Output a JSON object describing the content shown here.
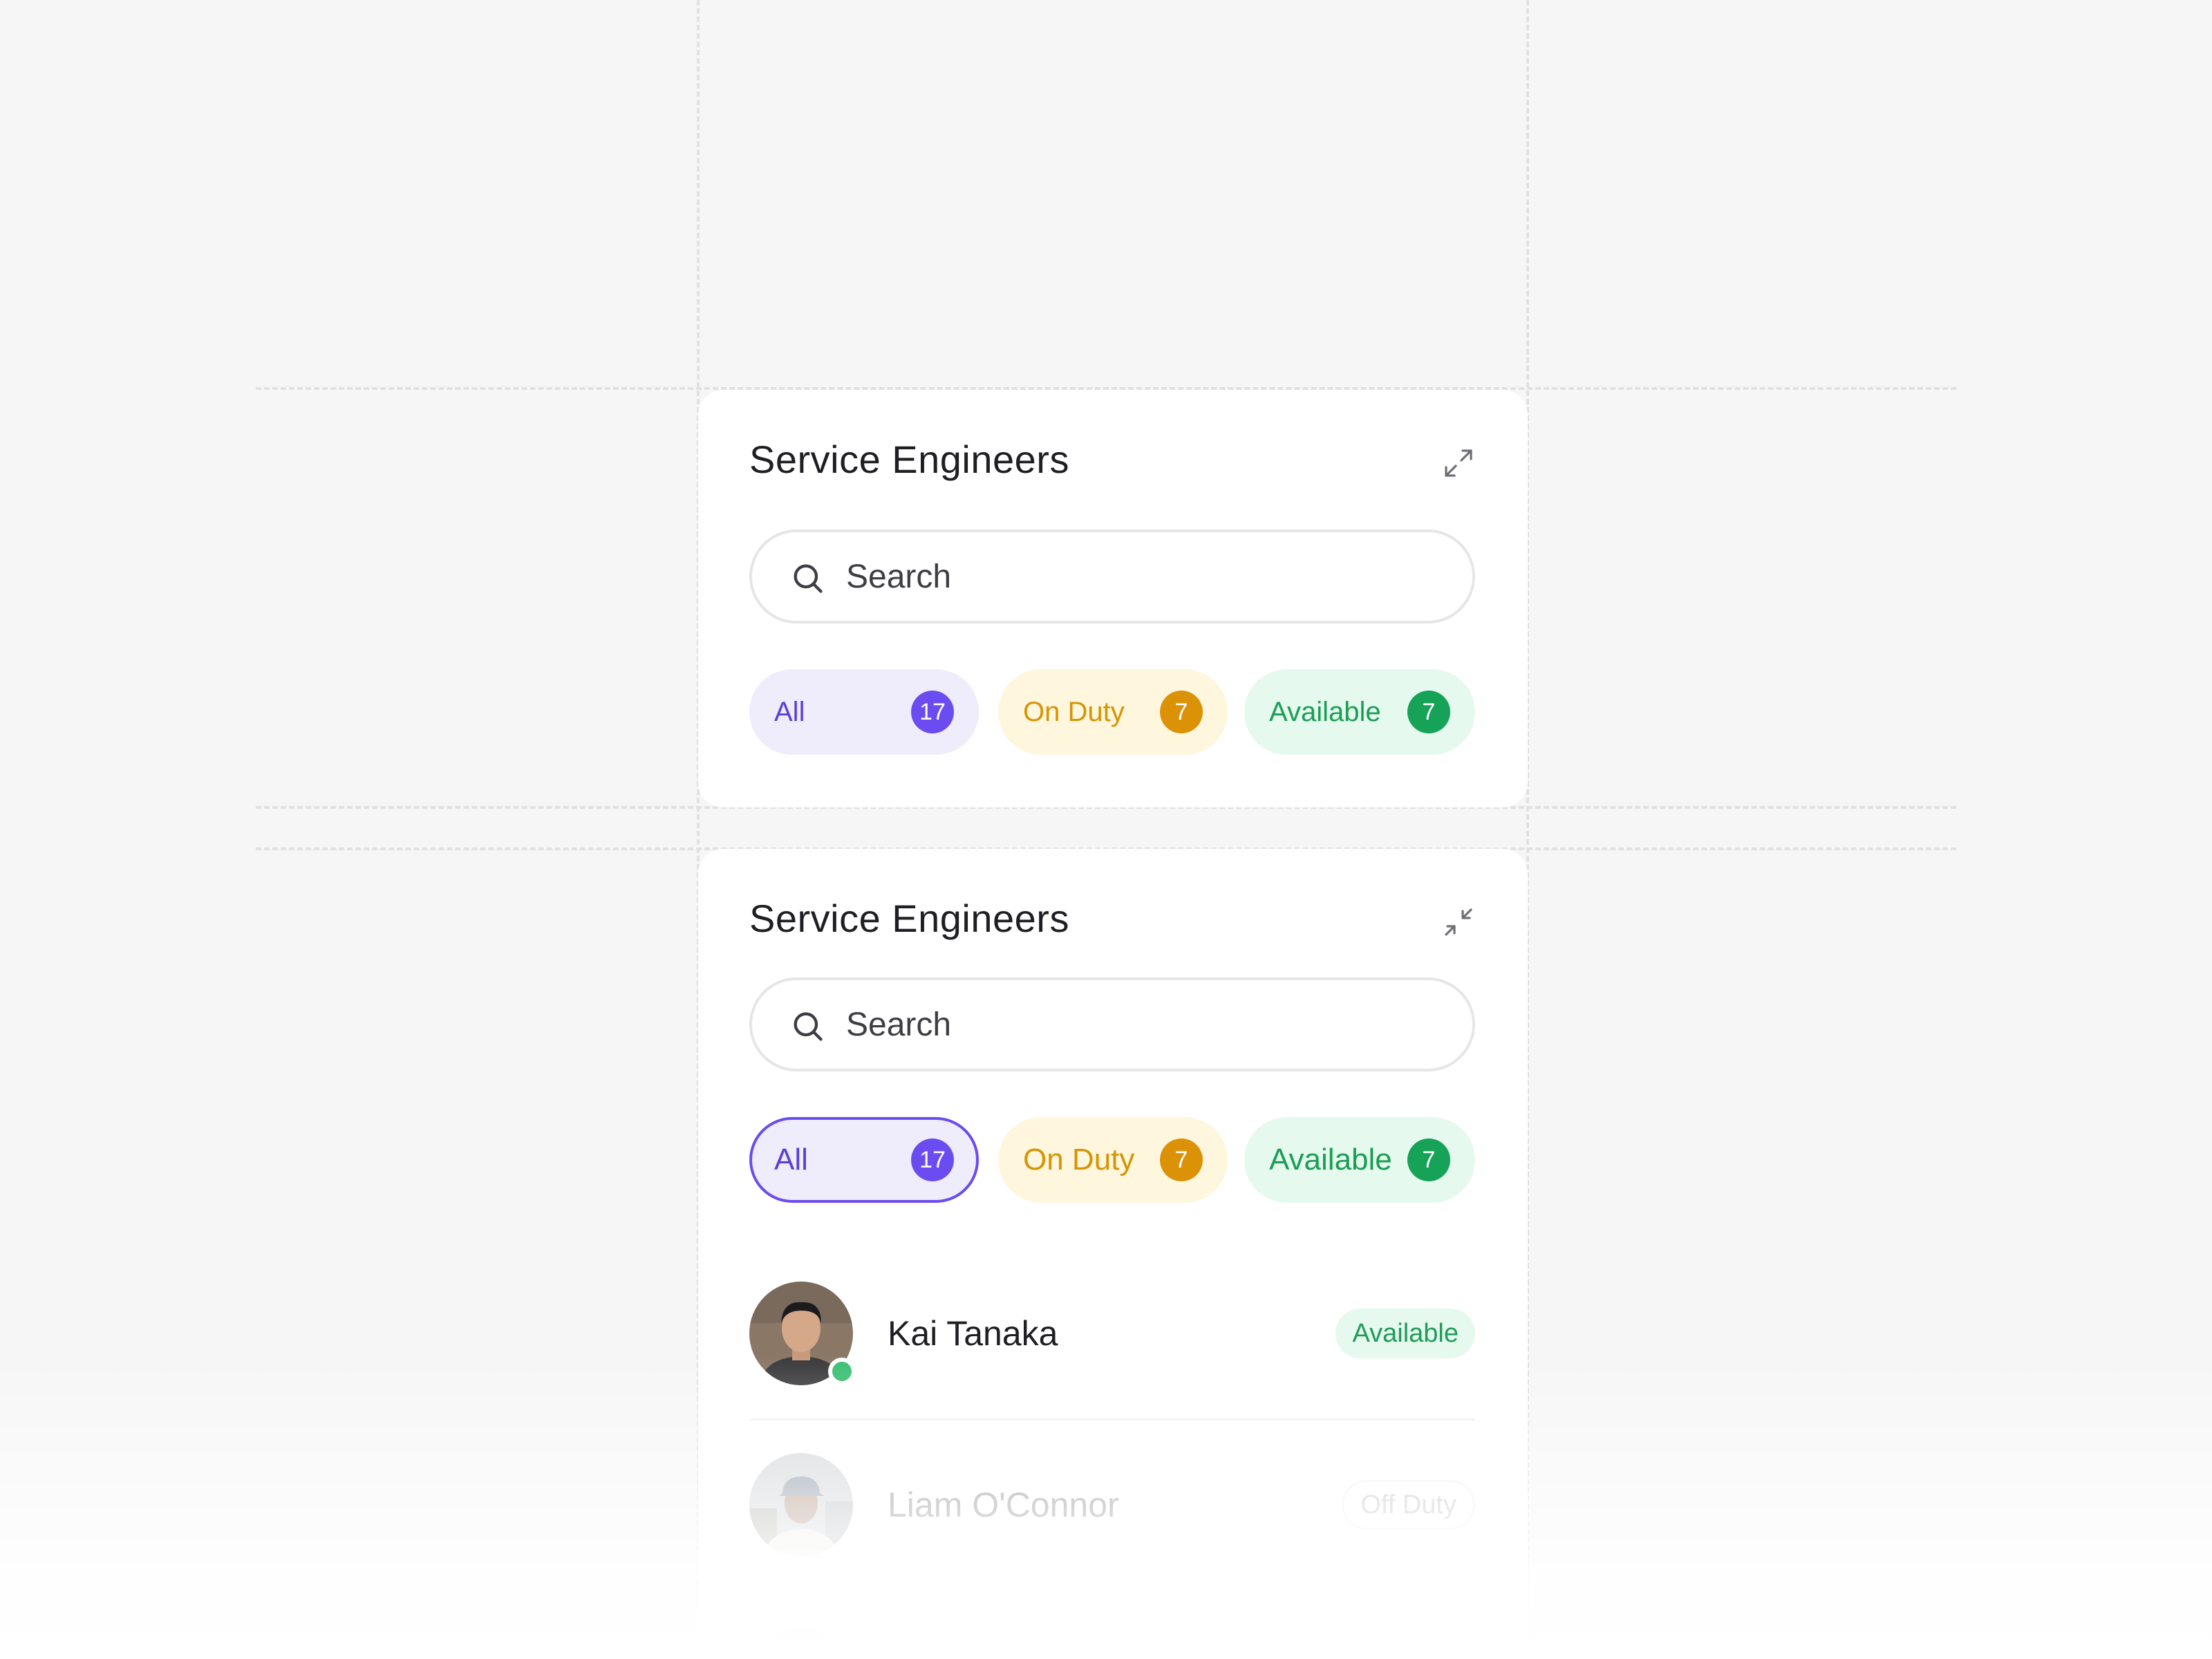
{
  "colors": {
    "background": "#f6f6f6",
    "card": "#ffffff",
    "accent_all": "#6b4cf0",
    "accent_on_duty": "#db9206",
    "accent_available": "#16a257",
    "presence_online": "#3bbf73"
  },
  "collapsed_card": {
    "title": "Service Engineers",
    "corner_icon": "expand-icon",
    "search": {
      "placeholder": "Search",
      "value": "",
      "icon": "search-icon"
    },
    "filters": [
      {
        "label": "All",
        "count": "17",
        "selected": false
      },
      {
        "label": "On Duty",
        "count": "7",
        "selected": false
      },
      {
        "label": "Available",
        "count": "7",
        "selected": false
      }
    ]
  },
  "expanded_card": {
    "title": "Service Engineers",
    "corner_icon": "collapse-icon",
    "search": {
      "placeholder": "Search",
      "value": "",
      "icon": "search-icon"
    },
    "filters": [
      {
        "label": "All",
        "count": "17",
        "selected": true
      },
      {
        "label": "On Duty",
        "count": "7",
        "selected": false
      },
      {
        "label": "Available",
        "count": "7",
        "selected": false
      }
    ],
    "engineers": [
      {
        "name": "Kai Tanaka",
        "status": "Available",
        "online": true
      },
      {
        "name": "Liam O'Connor",
        "status": "Off Duty",
        "online": false
      }
    ]
  }
}
